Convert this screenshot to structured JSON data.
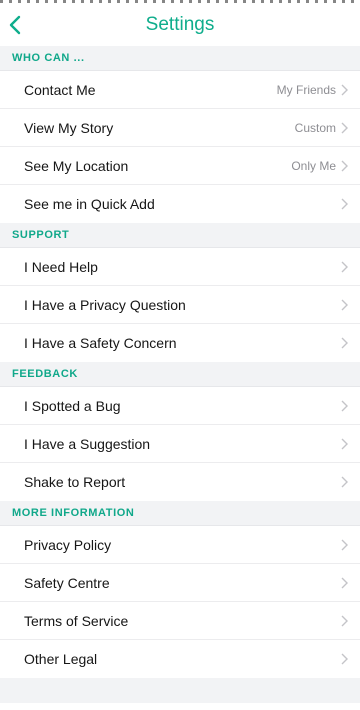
{
  "nav": {
    "title": "Settings",
    "back_icon": "chevron-left-icon",
    "accent_color": "#0fad8c"
  },
  "sections": [
    {
      "header": "WHO CAN ...",
      "items": [
        {
          "label": "Contact Me",
          "value": "My Friends"
        },
        {
          "label": "View My Story",
          "value": "Custom"
        },
        {
          "label": "See My Location",
          "value": "Only Me"
        },
        {
          "label": "See me in Quick Add",
          "value": ""
        }
      ]
    },
    {
      "header": "SUPPORT",
      "items": [
        {
          "label": "I Need Help",
          "value": ""
        },
        {
          "label": "I Have a Privacy Question",
          "value": ""
        },
        {
          "label": "I Have a Safety Concern",
          "value": ""
        }
      ]
    },
    {
      "header": "FEEDBACK",
      "items": [
        {
          "label": "I Spotted a Bug",
          "value": ""
        },
        {
          "label": "I Have a Suggestion",
          "value": ""
        },
        {
          "label": "Shake to Report",
          "value": ""
        }
      ]
    },
    {
      "header": "MORE INFORMATION",
      "items": [
        {
          "label": "Privacy Policy",
          "value": ""
        },
        {
          "label": "Safety Centre",
          "value": ""
        },
        {
          "label": "Terms of Service",
          "value": ""
        },
        {
          "label": "Other Legal",
          "value": ""
        }
      ]
    }
  ],
  "colors": {
    "section_header_text": "#10a88a",
    "section_header_bg": "#f2f3f5",
    "row_text": "#161616",
    "row_value": "#8e8e93",
    "chevron": "#c4c4c8"
  }
}
